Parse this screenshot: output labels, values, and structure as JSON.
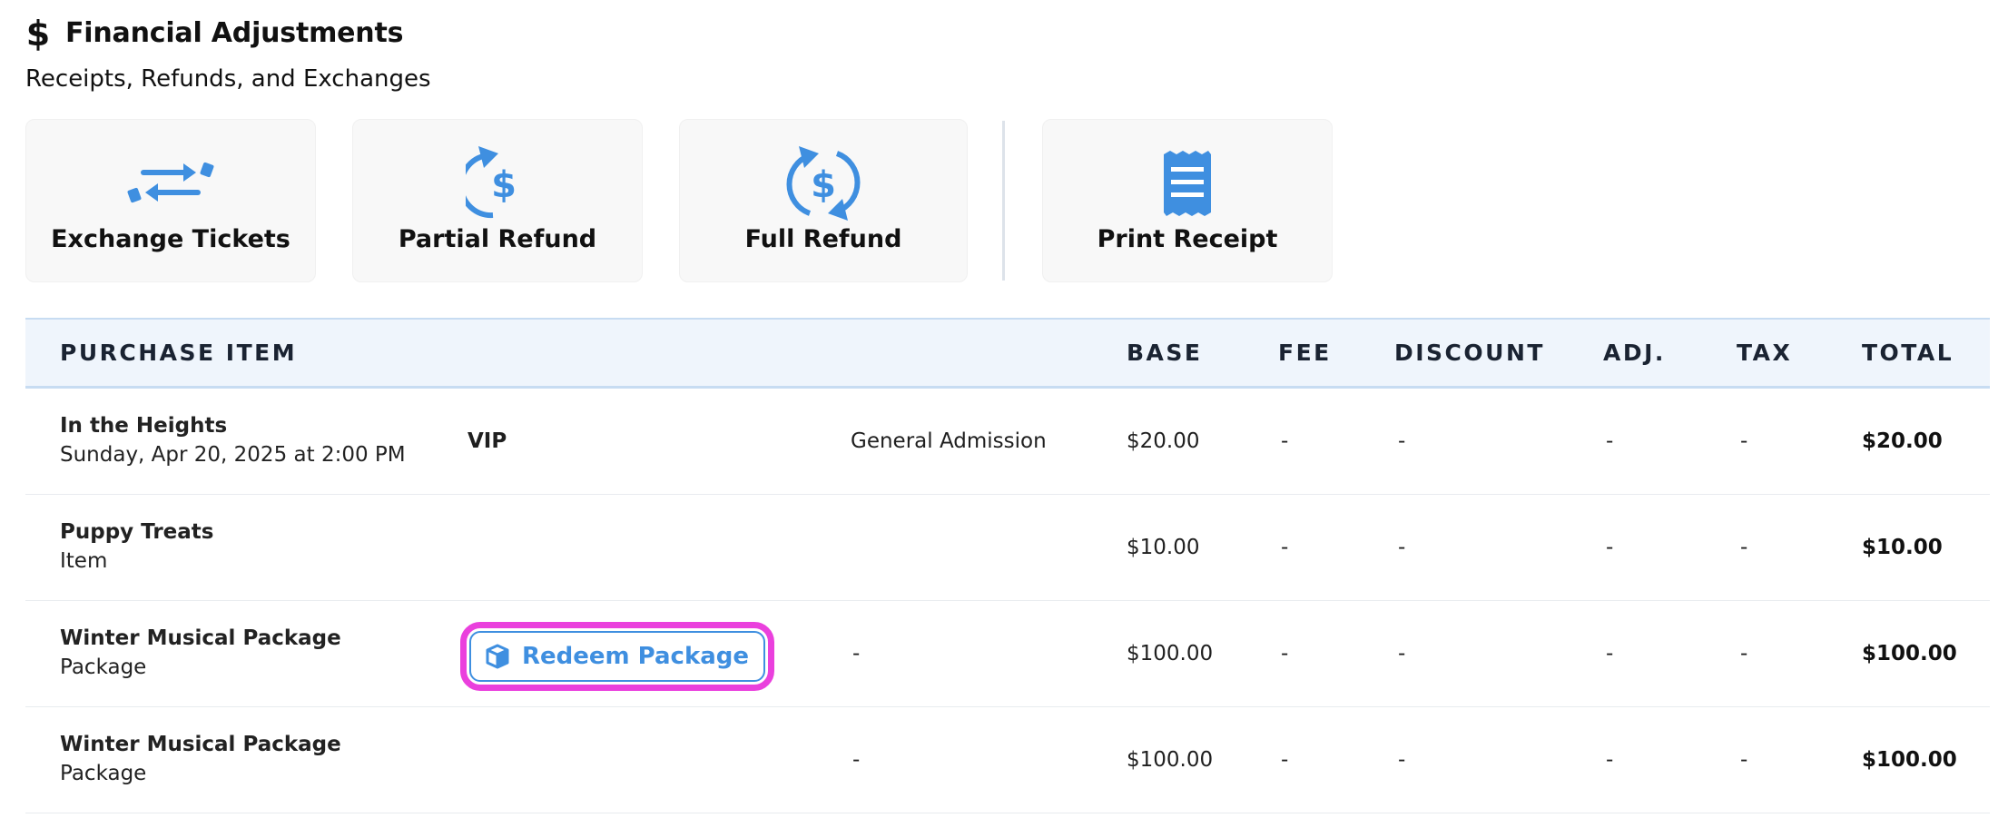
{
  "header": {
    "title": "Financial Adjustments",
    "subtitle": "Receipts, Refunds, and Exchanges"
  },
  "actions": [
    {
      "label": "Exchange Tickets",
      "icon": "exchange-arrows-icon"
    },
    {
      "label": "Partial Refund",
      "icon": "partial-refund-icon"
    },
    {
      "label": "Full Refund",
      "icon": "full-refund-icon"
    },
    {
      "label": "Print Receipt",
      "icon": "receipt-icon"
    }
  ],
  "table": {
    "headers": {
      "item": "PURCHASE ITEM",
      "base": "BASE",
      "fee": "FEE",
      "discount": "DISCOUNT",
      "adj": "ADJ.",
      "tax": "TAX",
      "total": "TOTAL"
    },
    "rows": [
      {
        "name": "In the Heights",
        "sub": "Sunday, Apr 20, 2025 at 2:00 PM",
        "variant": "VIP",
        "section": "General Admission",
        "base": "$20.00",
        "fee": "-",
        "discount": "-",
        "adj": "-",
        "tax": "-",
        "total": "$20.00"
      },
      {
        "name": "Puppy Treats",
        "sub": "Item",
        "base": "$10.00",
        "fee": "-",
        "discount": "-",
        "adj": "-",
        "tax": "-",
        "total": "$10.00"
      },
      {
        "name": "Winter Musical Package",
        "sub": "Package",
        "action": "Redeem Package",
        "section": "-",
        "base": "$100.00",
        "fee": "-",
        "discount": "-",
        "adj": "-",
        "tax": "-",
        "total": "$100.00"
      },
      {
        "name": "Winter Musical Package",
        "sub": "Package",
        "section": "-",
        "base": "$100.00",
        "fee": "-",
        "discount": "-",
        "adj": "-",
        "tax": "-",
        "total": "$100.00"
      }
    ]
  },
  "colors": {
    "accent": "#3f8fe0",
    "highlight": "#ea40dd",
    "header_bg": "#eff5fc"
  }
}
